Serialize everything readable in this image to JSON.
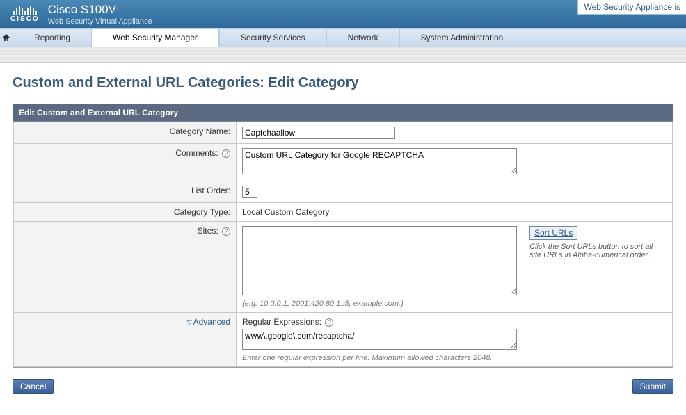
{
  "brand": {
    "vendor": "CISCO",
    "product": "Cisco S100V",
    "subtitle": "Web Security Virtual Appliance"
  },
  "top_right": "Web Security Appliance is",
  "nav": {
    "items": [
      "Reporting",
      "Web Security Manager",
      "Security Services",
      "Network",
      "System Administration"
    ],
    "active_index": 1
  },
  "page_title": "Custom and External URL Categories: Edit Category",
  "panel_header": "Edit Custom and External URL Category",
  "form": {
    "category_name": {
      "label": "Category Name:",
      "value": "Captchaallow"
    },
    "comments": {
      "label": "Comments:",
      "value": "Custom URL Category for Google RECAPTCHA"
    },
    "list_order": {
      "label": "List Order:",
      "value": "5"
    },
    "category_type": {
      "label": "Category Type:",
      "value": "Local Custom Category"
    },
    "sites": {
      "label": "Sites:",
      "value": "",
      "hint": "(e.g. 10.0.0.1, 2001:420:80:1::5, example.com.)",
      "sort_button": "Sort URLs",
      "sort_hint": "Click the Sort URLs button to sort all site URLs in Alpha-numerical order."
    },
    "advanced": {
      "toggle_label": "Advanced",
      "regex_label": "Regular Expressions:",
      "regex_value": "www\\.google\\.com/recaptcha/",
      "regex_hint": "Enter one regular expression per line. Maximum allowed characters 2048."
    }
  },
  "buttons": {
    "cancel": "Cancel",
    "submit": "Submit"
  }
}
